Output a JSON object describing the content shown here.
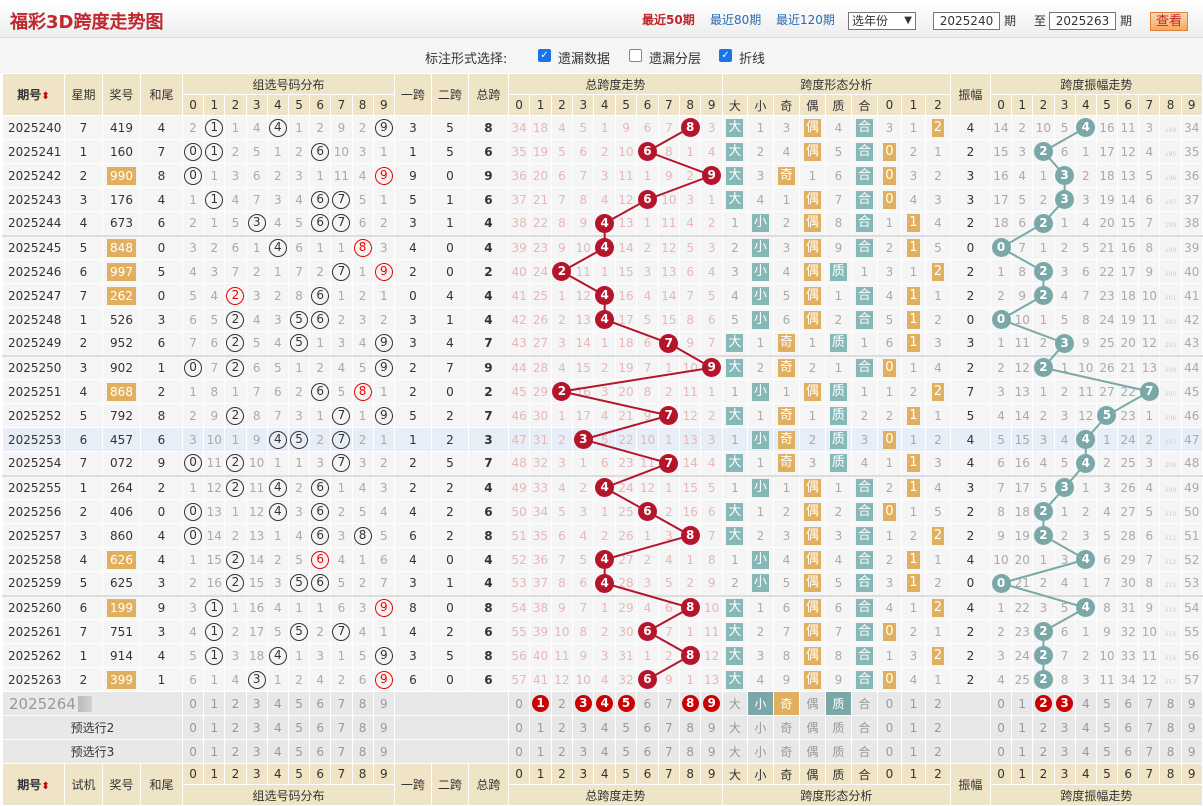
{
  "header": {
    "title": "福彩3D跨度走势图",
    "nav": [
      "最近50期",
      "最近80期",
      "最近120期"
    ],
    "year_select": "选年份",
    "from": "2025240",
    "period_label": "期",
    "to_label": "至",
    "to": "2025263",
    "view_button": "查看"
  },
  "options": {
    "label": "标注形式选择:",
    "items": [
      {
        "label": "遗漏数据",
        "checked": true
      },
      {
        "label": "遗漏分层",
        "checked": false
      },
      {
        "label": "折线",
        "checked": true
      }
    ]
  },
  "columns": {
    "period": "期号",
    "weekday": "星期",
    "number": "奖号",
    "sum_tail": "和尾",
    "group_dist": "组选号码分布",
    "span1": "一跨",
    "span2": "二跨",
    "span": "总跨",
    "span_trend": "总跨度走势",
    "shape": "跨度形态分析",
    "amp": "振幅",
    "amp_trend": "跨度振幅走势",
    "trial": "试机",
    "digits": [
      "0",
      "1",
      "2",
      "3",
      "4",
      "5",
      "6",
      "7",
      "8",
      "9"
    ],
    "shape_labels": [
      "大",
      "小",
      "奇",
      "偶",
      "质",
      "合",
      "0",
      "1",
      "2"
    ]
  },
  "colors": {
    "red_ball": "#b5152b",
    "teal": "#7aa8a8",
    "orange": "#e0b060",
    "title": "#c0272d"
  },
  "rows": [
    {
      "period": "2025240",
      "weekday": "7",
      "number": "419",
      "sum_tail": "4",
      "group": [
        2,
        1,
        1,
        4,
        4,
        1,
        2,
        9,
        2,
        9
      ],
      "span1": "3",
      "span2": "5",
      "span": "8",
      "span_miss": [
        34,
        18,
        4,
        5,
        1,
        9,
        6,
        7,
        8,
        3
      ],
      "shape": [
        "大",
        1,
        3,
        "偶",
        4,
        "合",
        3,
        1,
        2
      ],
      "amp": "4",
      "amp_miss": [
        14,
        2,
        10,
        5,
        4,
        16,
        11,
        3,
        194,
        34
      ]
    },
    {
      "period": "2025241",
      "weekday": "1",
      "number": "160",
      "sum_tail": "7",
      "group": [
        0,
        1,
        2,
        5,
        1,
        2,
        6,
        10,
        3,
        1
      ],
      "span1": "1",
      "span2": "5",
      "span": "6",
      "span_miss": [
        35,
        19,
        5,
        6,
        2,
        10,
        6,
        8,
        1,
        4
      ],
      "shape": [
        "大",
        2,
        4,
        "偶",
        5,
        "合",
        0,
        2,
        1
      ],
      "amp": "2",
      "amp_miss": [
        15,
        3,
        2,
        6,
        1,
        17,
        12,
        4,
        195,
        35
      ]
    },
    {
      "period": "2025242",
      "weekday": "2",
      "number": "990",
      "sum_tail": "8",
      "group": [
        0,
        1,
        3,
        6,
        2,
        3,
        1,
        11,
        4,
        9
      ],
      "span1": "9",
      "span2": "0",
      "span": "9",
      "span_miss": [
        36,
        20,
        6,
        7,
        3,
        11,
        1,
        9,
        2,
        9
      ],
      "shape": [
        "大",
        3,
        "奇",
        1,
        6,
        "合",
        0,
        3,
        2
      ],
      "amp": "3",
      "amp_miss": [
        16,
        4,
        1,
        3,
        2,
        18,
        13,
        5,
        196,
        36
      ]
    },
    {
      "period": "2025243",
      "weekday": "3",
      "number": "176",
      "sum_tail": "4",
      "group": [
        1,
        1,
        4,
        7,
        3,
        4,
        6,
        7,
        5,
        1
      ],
      "span1": "5",
      "span2": "1",
      "span": "6",
      "span_miss": [
        37,
        21,
        7,
        8,
        4,
        12,
        6,
        10,
        3,
        1
      ],
      "shape": [
        "大",
        4,
        1,
        "偶",
        7,
        "合",
        0,
        4,
        3
      ],
      "amp": "3",
      "amp_miss": [
        17,
        5,
        2,
        3,
        3,
        19,
        14,
        6,
        197,
        37
      ]
    },
    {
      "period": "2025244",
      "weekday": "4",
      "number": "673",
      "sum_tail": "6",
      "group": [
        2,
        1,
        5,
        3,
        4,
        5,
        6,
        7,
        6,
        2
      ],
      "span1": "3",
      "span2": "1",
      "span": "4",
      "span_miss": [
        38,
        22,
        8,
        9,
        4,
        13,
        1,
        11,
        4,
        2
      ],
      "shape": [
        1,
        "小",
        2,
        "偶",
        8,
        "合",
        1,
        1,
        4
      ],
      "amp": "2",
      "amp_miss": [
        18,
        6,
        2,
        1,
        4,
        20,
        15,
        7,
        198,
        38
      ]
    },
    {
      "period": "2025245",
      "weekday": "5",
      "number": "848",
      "sum_tail": "0",
      "group": [
        3,
        2,
        6,
        1,
        4,
        6,
        1,
        1,
        8,
        3
      ],
      "span1": "4",
      "span2": "0",
      "span": "4",
      "span_miss": [
        39,
        23,
        9,
        10,
        4,
        14,
        2,
        12,
        5,
        3
      ],
      "shape": [
        2,
        "小",
        3,
        "偶",
        9,
        "合",
        2,
        1,
        5
      ],
      "amp": "0",
      "amp_miss": [
        0,
        7,
        1,
        2,
        5,
        21,
        16,
        8,
        199,
        39
      ]
    },
    {
      "period": "2025246",
      "weekday": "6",
      "number": "997",
      "sum_tail": "5",
      "group": [
        4,
        3,
        7,
        2,
        1,
        7,
        2,
        7,
        1,
        9
      ],
      "span1": "2",
      "span2": "0",
      "span": "2",
      "span_miss": [
        40,
        24,
        2,
        11,
        1,
        15,
        3,
        13,
        6,
        4
      ],
      "shape": [
        3,
        "小",
        4,
        "偶",
        "质",
        1,
        3,
        1,
        2
      ],
      "amp": "2",
      "amp_miss": [
        1,
        8,
        2,
        3,
        6,
        22,
        17,
        9,
        200,
        40
      ]
    },
    {
      "period": "2025247",
      "weekday": "7",
      "number": "262",
      "sum_tail": "0",
      "group": [
        5,
        4,
        2,
        3,
        2,
        8,
        6,
        1,
        2,
        1
      ],
      "span1": "0",
      "span2": "4",
      "span": "4",
      "span_miss": [
        41,
        25,
        1,
        12,
        4,
        16,
        4,
        14,
        7,
        5
      ],
      "shape": [
        4,
        "小",
        5,
        "偶",
        1,
        "合",
        4,
        1,
        1
      ],
      "amp": "2",
      "amp_miss": [
        2,
        9,
        2,
        4,
        7,
        23,
        18,
        10,
        201,
        41
      ]
    },
    {
      "period": "2025248",
      "weekday": "1",
      "number": "526",
      "sum_tail": "3",
      "group": [
        6,
        5,
        2,
        4,
        3,
        5,
        6,
        2,
        3,
        2
      ],
      "span1": "3",
      "span2": "1",
      "span": "4",
      "span_miss": [
        42,
        26,
        2,
        13,
        4,
        17,
        5,
        15,
        8,
        6
      ],
      "shape": [
        5,
        "小",
        6,
        "偶",
        2,
        "合",
        5,
        1,
        2
      ],
      "amp": "0",
      "amp_miss": [
        0,
        10,
        1,
        5,
        8,
        24,
        19,
        11,
        202,
        42
      ]
    },
    {
      "period": "2025249",
      "weekday": "2",
      "number": "952",
      "sum_tail": "6",
      "group": [
        7,
        6,
        2,
        5,
        4,
        5,
        1,
        3,
        4,
        9
      ],
      "span1": "3",
      "span2": "4",
      "span": "7",
      "span_miss": [
        43,
        27,
        3,
        14,
        1,
        18,
        6,
        7,
        9,
        7
      ],
      "shape": [
        "大",
        1,
        "奇",
        1,
        "质",
        1,
        6,
        1,
        3
      ],
      "amp": "3",
      "amp_miss": [
        1,
        11,
        2,
        3,
        9,
        25,
        20,
        12,
        203,
        43
      ]
    },
    {
      "period": "2025250",
      "weekday": "3",
      "number": "902",
      "sum_tail": "1",
      "group": [
        0,
        7,
        2,
        6,
        5,
        1,
        2,
        4,
        5,
        9
      ],
      "span1": "2",
      "span2": "7",
      "span": "9",
      "span_miss": [
        44,
        28,
        4,
        15,
        2,
        19,
        7,
        1,
        10,
        9
      ],
      "shape": [
        "大",
        2,
        "奇",
        2,
        1,
        "合",
        0,
        1,
        4
      ],
      "amp": "2",
      "amp_miss": [
        2,
        12,
        2,
        1,
        10,
        26,
        21,
        13,
        204,
        44
      ]
    },
    {
      "period": "2025251",
      "weekday": "4",
      "number": "868",
      "sum_tail": "2",
      "group": [
        1,
        8,
        1,
        7,
        6,
        2,
        6,
        5,
        8,
        1
      ],
      "span1": "2",
      "span2": "0",
      "span": "2",
      "span_miss": [
        45,
        29,
        2,
        16,
        3,
        20,
        8,
        2,
        11,
        1
      ],
      "shape": [
        1,
        "小",
        1,
        "偶",
        "质",
        1,
        1,
        2,
        2
      ],
      "amp": "7",
      "amp_miss": [
        3,
        13,
        1,
        2,
        11,
        27,
        22,
        7,
        205,
        45
      ]
    },
    {
      "period": "2025252",
      "weekday": "5",
      "number": "792",
      "sum_tail": "8",
      "group": [
        2,
        9,
        2,
        8,
        7,
        3,
        1,
        7,
        1,
        9
      ],
      "span1": "5",
      "span2": "2",
      "span": "7",
      "span_miss": [
        46,
        30,
        1,
        17,
        4,
        21,
        9,
        7,
        12,
        2
      ],
      "shape": [
        "大",
        1,
        "奇",
        1,
        "质",
        2,
        2,
        1,
        1
      ],
      "amp": "5",
      "amp_miss": [
        4,
        14,
        2,
        3,
        12,
        5,
        23,
        1,
        206,
        46
      ]
    },
    {
      "period": "2025253",
      "weekday": "6",
      "number": "457",
      "sum_tail": "6",
      "group": [
        3,
        10,
        1,
        9,
        4,
        5,
        2,
        7,
        2,
        1
      ],
      "span1": "1",
      "span2": "2",
      "span": "3",
      "span_miss": [
        47,
        31,
        2,
        3,
        5,
        22,
        10,
        1,
        13,
        3
      ],
      "shape": [
        1,
        "小",
        "奇",
        2,
        "质",
        3,
        0,
        1,
        2
      ],
      "amp": "4",
      "amp_miss": [
        5,
        15,
        3,
        4,
        4,
        1,
        24,
        2,
        207,
        47
      ]
    },
    {
      "period": "2025254",
      "weekday": "7",
      "number": "072",
      "sum_tail": "9",
      "group": [
        0,
        11,
        2,
        10,
        1,
        1,
        3,
        7,
        3,
        2
      ],
      "span1": "2",
      "span2": "5",
      "span": "7",
      "span_miss": [
        48,
        32,
        3,
        1,
        6,
        23,
        11,
        7,
        14,
        4
      ],
      "shape": [
        "大",
        1,
        "奇",
        3,
        "质",
        4,
        1,
        1,
        3
      ],
      "amp": "4",
      "amp_miss": [
        6,
        16,
        4,
        5,
        4,
        2,
        25,
        3,
        208,
        48
      ]
    },
    {
      "period": "2025255",
      "weekday": "1",
      "number": "264",
      "sum_tail": "2",
      "group": [
        1,
        12,
        2,
        11,
        4,
        2,
        6,
        1,
        4,
        3
      ],
      "span1": "2",
      "span2": "2",
      "span": "4",
      "span_miss": [
        49,
        33,
        4,
        2,
        4,
        24,
        12,
        1,
        15,
        5
      ],
      "shape": [
        1,
        "小",
        1,
        "偶",
        1,
        "合",
        2,
        1,
        4
      ],
      "amp": "3",
      "amp_miss": [
        7,
        17,
        5,
        3,
        1,
        3,
        26,
        4,
        209,
        49
      ]
    },
    {
      "period": "2025256",
      "weekday": "2",
      "number": "406",
      "sum_tail": "0",
      "group": [
        0,
        13,
        1,
        12,
        4,
        3,
        6,
        2,
        5,
        4
      ],
      "span1": "4",
      "span2": "2",
      "span": "6",
      "span_miss": [
        50,
        34,
        5,
        3,
        1,
        25,
        6,
        2,
        16,
        6
      ],
      "shape": [
        "大",
        1,
        2,
        "偶",
        2,
        "合",
        0,
        1,
        5
      ],
      "amp": "2",
      "amp_miss": [
        8,
        18,
        2,
        1,
        2,
        4,
        27,
        5,
        210,
        50
      ]
    },
    {
      "period": "2025257",
      "weekday": "3",
      "number": "860",
      "sum_tail": "4",
      "group": [
        0,
        14,
        2,
        13,
        1,
        4,
        6,
        3,
        8,
        5
      ],
      "span1": "6",
      "span2": "2",
      "span": "8",
      "span_miss": [
        51,
        35,
        6,
        4,
        2,
        26,
        1,
        3,
        8,
        7
      ],
      "shape": [
        "大",
        2,
        3,
        "偶",
        3,
        "合",
        1,
        2,
        2
      ],
      "amp": "2",
      "amp_miss": [
        9,
        19,
        2,
        2,
        3,
        5,
        28,
        6,
        211,
        51
      ]
    },
    {
      "period": "2025258",
      "weekday": "4",
      "number": "626",
      "sum_tail": "4",
      "group": [
        1,
        15,
        2,
        14,
        2,
        5,
        6,
        4,
        1,
        6
      ],
      "span1": "4",
      "span2": "0",
      "span": "4",
      "span_miss": [
        52,
        36,
        7,
        5,
        4,
        27,
        2,
        4,
        1,
        8
      ],
      "shape": [
        1,
        "小",
        4,
        "偶",
        4,
        "合",
        2,
        1,
        1
      ],
      "amp": "4",
      "amp_miss": [
        10,
        20,
        1,
        3,
        4,
        6,
        29,
        7,
        212,
        52
      ]
    },
    {
      "period": "2025259",
      "weekday": "5",
      "number": "625",
      "sum_tail": "3",
      "group": [
        2,
        16,
        2,
        15,
        3,
        5,
        6,
        5,
        2,
        7
      ],
      "span1": "3",
      "span2": "1",
      "span": "4",
      "span_miss": [
        53,
        37,
        8,
        6,
        4,
        28,
        3,
        5,
        2,
        9
      ],
      "shape": [
        2,
        "小",
        5,
        "偶",
        5,
        "合",
        3,
        1,
        2
      ],
      "amp": "0",
      "amp_miss": [
        0,
        21,
        2,
        4,
        1,
        7,
        30,
        8,
        213,
        53
      ]
    },
    {
      "period": "2025260",
      "weekday": "6",
      "number": "199",
      "sum_tail": "9",
      "group": [
        3,
        1,
        1,
        16,
        4,
        1,
        1,
        6,
        3,
        9
      ],
      "span1": "8",
      "span2": "0",
      "span": "8",
      "span_miss": [
        54,
        38,
        9,
        7,
        1,
        29,
        4,
        6,
        8,
        10
      ],
      "shape": [
        "大",
        1,
        6,
        "偶",
        6,
        "合",
        4,
        1,
        2
      ],
      "amp": "4",
      "amp_miss": [
        1,
        22,
        3,
        5,
        4,
        8,
        31,
        9,
        214,
        54
      ]
    },
    {
      "period": "2025261",
      "weekday": "7",
      "number": "751",
      "sum_tail": "3",
      "group": [
        4,
        1,
        2,
        17,
        5,
        5,
        2,
        7,
        4,
        1
      ],
      "span1": "4",
      "span2": "2",
      "span": "6",
      "span_miss": [
        55,
        39,
        10,
        8,
        2,
        30,
        6,
        7,
        1,
        11
      ],
      "shape": [
        "大",
        2,
        7,
        "偶",
        7,
        "合",
        0,
        2,
        1
      ],
      "amp": "2",
      "amp_miss": [
        2,
        23,
        2,
        6,
        1,
        9,
        32,
        10,
        215,
        55
      ]
    },
    {
      "period": "2025262",
      "weekday": "1",
      "number": "914",
      "sum_tail": "4",
      "group": [
        5,
        1,
        3,
        18,
        4,
        1,
        3,
        1,
        5,
        9
      ],
      "span1": "3",
      "span2": "5",
      "span": "8",
      "span_miss": [
        56,
        40,
        11,
        9,
        3,
        31,
        1,
        2,
        8,
        12
      ],
      "shape": [
        "大",
        3,
        8,
        "偶",
        8,
        "合",
        1,
        3,
        2
      ],
      "amp": "2",
      "amp_miss": [
        3,
        24,
        2,
        7,
        2,
        10,
        33,
        11,
        216,
        56
      ]
    },
    {
      "period": "2025263",
      "weekday": "2",
      "number": "399",
      "sum_tail": "1",
      "group": [
        6,
        1,
        4,
        3,
        1,
        2,
        4,
        2,
        6,
        9
      ],
      "span1": "6",
      "span2": "0",
      "span": "6",
      "span_miss": [
        57,
        41,
        12,
        10,
        4,
        32,
        6,
        9,
        1,
        13
      ],
      "shape": [
        "大",
        4,
        9,
        "偶",
        9,
        "合",
        0,
        4,
        1
      ],
      "amp": "2",
      "amp_miss": [
        4,
        25,
        2,
        8,
        3,
        11,
        34,
        12,
        217,
        57
      ]
    }
  ],
  "predict": [
    {
      "label": "2025264",
      "span_hits": [
        1,
        3,
        4,
        5,
        8,
        9
      ],
      "shape_hits": [
        "小",
        "奇",
        "质"
      ],
      "amp_hits": [
        2,
        3
      ]
    },
    {
      "label": "预选行2",
      "span_hits": [],
      "shape_hits": [],
      "amp_hits": []
    },
    {
      "label": "预选行3",
      "span_hits": [],
      "shape_hits": [],
      "amp_hits": []
    }
  ]
}
